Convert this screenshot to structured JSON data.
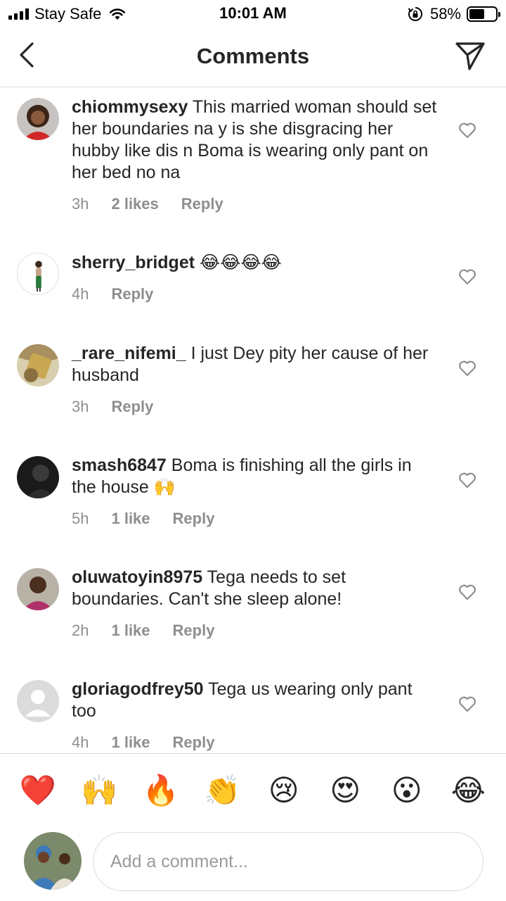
{
  "status_bar": {
    "carrier": "Stay Safe",
    "time": "10:01 AM",
    "battery_percent_label": "58%",
    "battery_level": 0.58
  },
  "header": {
    "title": "Comments"
  },
  "comments": [
    {
      "username": "chiommysexy",
      "text": "This married woman should set her boundaries na y is she disgracing her hubby like dis n Boma is wearing only pant on her bed no na",
      "time": "3h",
      "likes": "2 likes",
      "reply": "Reply"
    },
    {
      "username": "sherry_bridget",
      "text": "😂😂😂😂",
      "time": "4h",
      "likes": "",
      "reply": "Reply"
    },
    {
      "username": "_rare_nifemi_",
      "text": "I just Dey pity her cause of her husband",
      "time": "3h",
      "likes": "",
      "reply": "Reply"
    },
    {
      "username": "smash6847",
      "text": "Boma is finishing all the girls in the house 🙌",
      "time": "5h",
      "likes": "1 like",
      "reply": "Reply"
    },
    {
      "username": "oluwatoyin8975",
      "text": "Tega needs to set boundaries. Can't she sleep alone!",
      "time": "2h",
      "likes": "1 like",
      "reply": "Reply"
    },
    {
      "username": "gloriagodfrey50",
      "text": "Tega us wearing only pant too",
      "time": "4h",
      "likes": "1 like",
      "reply": "Reply"
    }
  ],
  "reactions": [
    "❤️",
    "🙌",
    "🔥",
    "👏",
    "😢",
    "😍",
    "😮",
    "😂"
  ],
  "input": {
    "placeholder": "Add a comment..."
  },
  "colors": {
    "text": "#262626",
    "secondary": "#8e8e8e",
    "divider": "#dbdbdb"
  }
}
